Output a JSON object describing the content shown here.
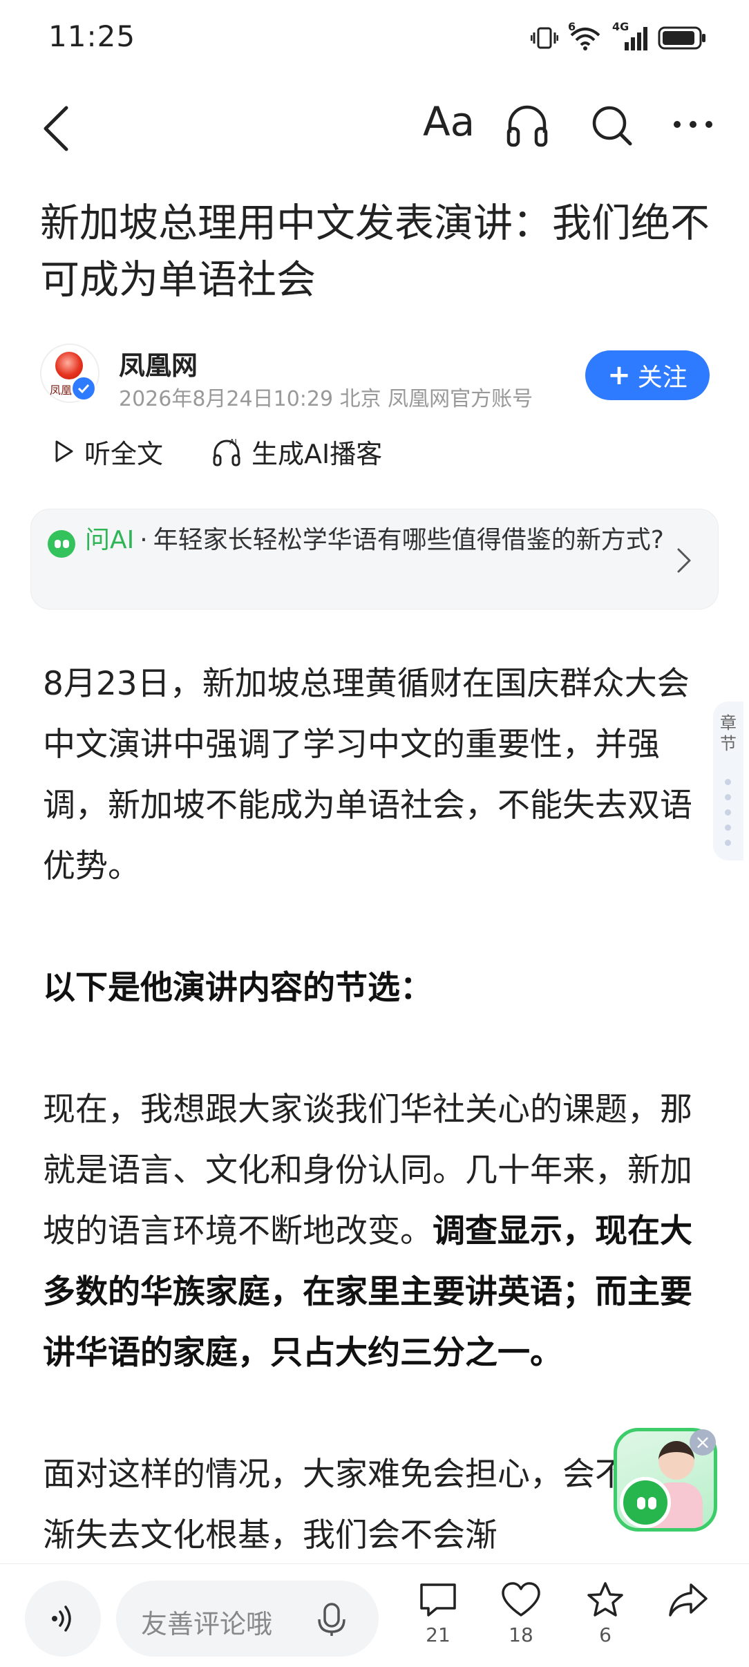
{
  "status_bar": {
    "time": "11:25",
    "icons": [
      "vibrate-icon",
      "wifi-icon",
      "signal-4g-icon",
      "battery-icon"
    ],
    "wifi_badge": "6",
    "network_badge": "4G"
  },
  "nav": {
    "back_icon": "chevron-left-icon",
    "font_size_label": "Aa",
    "listen_icon": "headphones-icon",
    "search_icon": "search-icon",
    "more_icon": "more-dots-icon"
  },
  "article": {
    "headline": "新加坡总理用中文发表演讲：我们绝不可成为单语社会",
    "author": {
      "name": "凤凰网",
      "meta": "2026年8月24日10:29 北京 凤凰网官方账号",
      "logo_text": "凤凰",
      "verified": true
    },
    "follow_label": "关注",
    "listen_label": "听全文",
    "podcast_label": "生成AI播客",
    "ai_card": {
      "label": "问AI",
      "separator": "·",
      "question": "年轻家长轻松学华语有哪些值得借鉴的新方式?"
    },
    "paragraphs": {
      "p1": "8月23日，新加坡总理黄循财在国庆群众大会中文演讲中强调了学习中文的重要性，并强调，新加坡不能成为单语社会，不能失去双语优势。",
      "p2": "以下是他演讲内容的节选：",
      "p3_normal": "现在，我想跟大家谈我们华社关心的课题，那就是语言、文化和身份认同。几十年来，新加坡的语言环境不断地改变。",
      "p3_bold": "调查显示，现在大多数的华族家庭，在家里主要讲英语；而主要讲华语的家庭，只占大约三分之一。",
      "p4": "面对这样的情况，大家难免会担心，会不会渐渐失去文化根基，我们会不会渐"
    }
  },
  "chapter_tab": {
    "label": "章节",
    "dots": 5
  },
  "assistant": {
    "close_label": "×"
  },
  "bottom_bar": {
    "comment_placeholder": "友善评论哦",
    "comment_count": "21",
    "like_count": "18",
    "favorite_count": "6",
    "share_label": ""
  },
  "colors": {
    "accent_blue": "#2f7bff",
    "ai_green": "#2eb556",
    "text": "#222222",
    "meta_gray": "#999999"
  }
}
